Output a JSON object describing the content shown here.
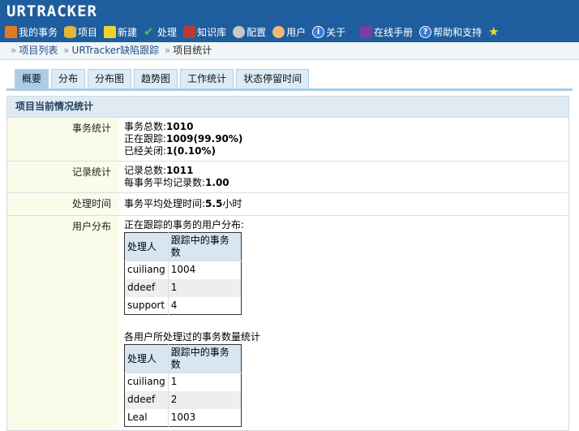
{
  "app": {
    "logo": "URTRACKER"
  },
  "nav": [
    {
      "icon": "home-icon",
      "label": "我的事务"
    },
    {
      "icon": "database-icon",
      "label": "项目"
    },
    {
      "icon": "new-icon",
      "label": "新建"
    },
    {
      "icon": "check-icon",
      "label": "处理"
    },
    {
      "icon": "books-icon",
      "label": "知识库"
    },
    {
      "icon": "gear-icon",
      "label": "配置"
    },
    {
      "icon": "users-icon",
      "label": "用户"
    },
    {
      "icon": "info-icon",
      "label": "关于"
    },
    {
      "icon": "manual-icon",
      "label": "在线手册"
    },
    {
      "icon": "help-icon",
      "label": "帮助和支持"
    },
    {
      "icon": "star-icon",
      "label": ""
    }
  ],
  "breadcrumb": {
    "item1": "项目列表",
    "item2": "URTracker缺陷跟踪",
    "current": "项目统计"
  },
  "tabs": [
    "概要",
    "分布",
    "分布图",
    "趋势图",
    "工作统计",
    "状态停留时间"
  ],
  "panel": {
    "title": "项目当前情况统计",
    "affairs": {
      "label": "事务统计",
      "total_label": "事务总数:",
      "total": "1010",
      "tracking_label": "正在跟踪:",
      "tracking": "1009(99.90%)",
      "closed_label": "已经关闭:",
      "closed": "1(0.10%)"
    },
    "records": {
      "label": "记录统计",
      "total_label": "记录总数:",
      "total": "1011",
      "avg_label": "每事务平均记录数:",
      "avg": "1.00"
    },
    "time": {
      "label": "处理时间",
      "text_prefix": "事务平均处理时间:",
      "value": "5.5",
      "unit": "小时"
    },
    "users": {
      "label": "用户分布",
      "table1": {
        "caption": "正在跟踪的事务的用户分布:",
        "headers": [
          "处理人",
          "跟踪中的事务数"
        ],
        "rows": [
          [
            "cuiliang",
            "1004"
          ],
          [
            "ddeef",
            "1"
          ],
          [
            "support",
            "4"
          ]
        ]
      },
      "table2": {
        "caption": "各用户所处理过的事务数量统计",
        "headers": [
          "处理人",
          "跟踪中的事务数"
        ],
        "rows": [
          [
            "cuiliang",
            "1"
          ],
          [
            "ddeef",
            "2"
          ],
          [
            "Leal",
            "1003"
          ]
        ]
      }
    }
  },
  "colors": {
    "topbar": "#1f5e9e",
    "tab_active": "#a9cde6",
    "label_bg": "#fbfbea"
  }
}
